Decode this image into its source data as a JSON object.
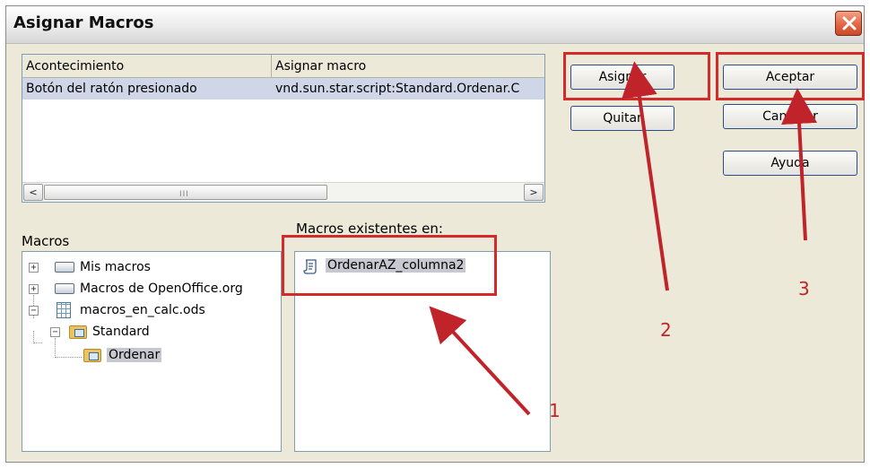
{
  "dialog": {
    "title": "Asignar Macros"
  },
  "events_table": {
    "columns": [
      "Acontecimiento",
      "Asignar macro"
    ],
    "rows": [
      {
        "event": "Botón del ratón presionado",
        "macro": "vnd.sun.star.script:Standard.Ordenar.C"
      }
    ],
    "scroll_left": "<",
    "scroll_right": ">",
    "scroll_grip": "III"
  },
  "macros_label": "Macros",
  "macros_existing_label": "Macros existentes en:",
  "tree": {
    "items": [
      {
        "label": "Mis macros",
        "expander": "+"
      },
      {
        "label": "Macros de OpenOffice.org",
        "expander": "+"
      },
      {
        "label": "macros_en_calc.ods",
        "expander": "−"
      },
      {
        "label": "Standard",
        "expander": "−"
      },
      {
        "label": "Ordenar"
      }
    ]
  },
  "existing_macros": [
    "OrdenarAZ_columna2"
  ],
  "buttons": {
    "assign": "Asignar",
    "remove": "Quitar",
    "accept": "Aceptar",
    "cancel": "Cancelar",
    "help": "Ayuda"
  },
  "annotations": {
    "step1": "1",
    "step2": "2",
    "step3": "3",
    "color": "#c0242a"
  },
  "icons": {
    "close": "close-icon",
    "drive": "drive-icon",
    "spreadsheet": "spreadsheet-icon",
    "library": "library-folder-icon",
    "module": "module-folder-icon",
    "macro": "script-icon"
  }
}
